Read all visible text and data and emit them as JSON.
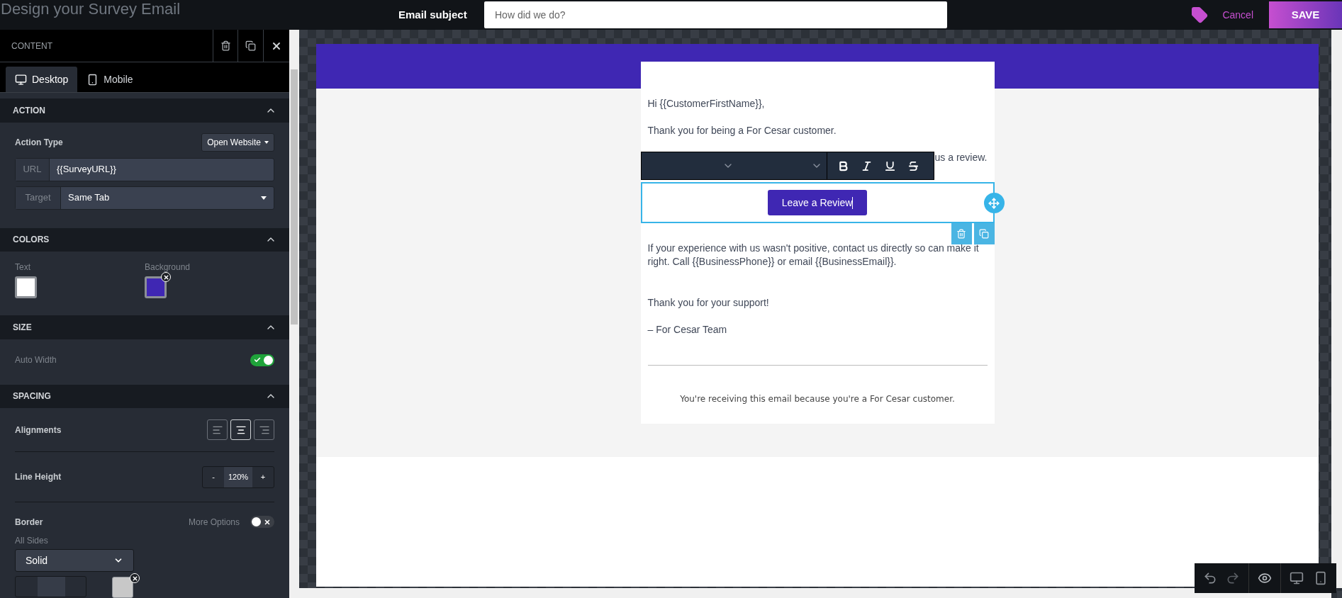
{
  "header": {
    "title": "Design your Survey Email",
    "subject_label": "Email subject",
    "subject_placeholder": "How did we do?",
    "cancel": "Cancel",
    "save": "SAVE"
  },
  "panel": {
    "title": "CONTENT",
    "tabs": [
      {
        "label": "Desktop",
        "kind": "desktop",
        "selected": true
      },
      {
        "label": "Mobile",
        "kind": "mobile",
        "selected": false
      }
    ],
    "action": {
      "title": "ACTION",
      "expanded": true,
      "type_label": "Action Type",
      "type_value": "Open Website",
      "url_label": "URL",
      "url_value": "{{SurveyURL}}",
      "target_label": "Target",
      "target_value": "Same Tab"
    },
    "colors": {
      "title": "COLORS",
      "expanded": true,
      "items": [
        {
          "label": "Text",
          "color": "#ffffff",
          "clearable": false
        },
        {
          "label": "Background",
          "color": "#3f27b3",
          "clearable": true
        }
      ]
    },
    "size": {
      "title": "SIZE",
      "expanded": true,
      "auto_width_label": "Auto Width",
      "auto_width_on": true
    },
    "spacing": {
      "title": "SPACING",
      "expanded": true,
      "alignments_label": "Alignments",
      "alignments": [
        {
          "kind": "left",
          "selected": false
        },
        {
          "kind": "center",
          "selected": true
        },
        {
          "kind": "right",
          "selected": false
        }
      ],
      "line_height_label": "Line Height",
      "minus": "-",
      "line_height_value": "120%",
      "plus": "+",
      "border_label": "Border",
      "more_options_label": "More Options",
      "more_options_on": false,
      "all_sides_label": "All Sides",
      "border_style": "Solid"
    }
  },
  "email": {
    "greeting": "Hi {{CustomerFirstName}},",
    "thanks": "Thank you for being a For Cesar customer.",
    "review_line_visible": "us a review.",
    "button": "Leave a Review",
    "paragraph": "If your experience with us wasn't positive, contact us directly so can make it right. Call {{BusinessPhone}} or email {{BusinessEmail}}.",
    "support": "Thank you for your support!",
    "signature": "– For Cesar Team",
    "footer": "You're receiving this email because you're a For Cesar customer."
  }
}
